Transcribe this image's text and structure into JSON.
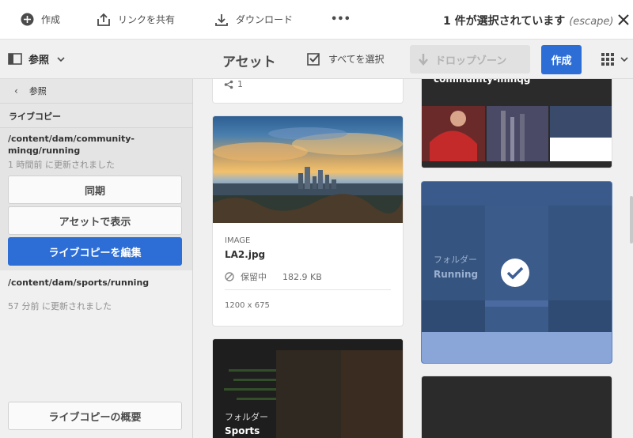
{
  "selection_bar": {
    "create_label": "作成",
    "share_link_label": "リンクを共有",
    "download_label": "ダウンロード",
    "more_label": "•••",
    "selected_text": "1 件が選択されています",
    "escape_hint": "(escape)"
  },
  "action_bar": {
    "rail_label": "参照",
    "title": "アセット",
    "select_all_label": "すべてを選択",
    "dropzone_label": "ドロップゾーン",
    "create_label": "作成"
  },
  "rail": {
    "back_label": "参照",
    "heading": "ライブコピー",
    "livecopies": [
      {
        "path": "/content/dam/community-minqg/running",
        "updated": "1 時間前 に更新されました",
        "buttons": [
          "同期",
          "アセットで表示",
          "ライブコピーを編集"
        ]
      },
      {
        "path": "/content/dam/sports/running",
        "updated": "57 分前 に更新されました"
      }
    ],
    "overview_label": "ライブコピーの概要"
  },
  "cards": {
    "top_share_count": "1",
    "la2": {
      "type": "IMAGE",
      "name": "LA2.jpg",
      "status": "保留中",
      "size": "182.9 KB",
      "dimensions": "1200 x 675"
    },
    "sports": {
      "label": "フォルダー",
      "name": "Sports"
    },
    "community": {
      "name": "community-minqg"
    },
    "running": {
      "label": "フォルダー",
      "name": "Running",
      "selected": true
    }
  },
  "colors": {
    "accent": "#2d6ed6",
    "selected_overlay": "#3d5f94"
  }
}
